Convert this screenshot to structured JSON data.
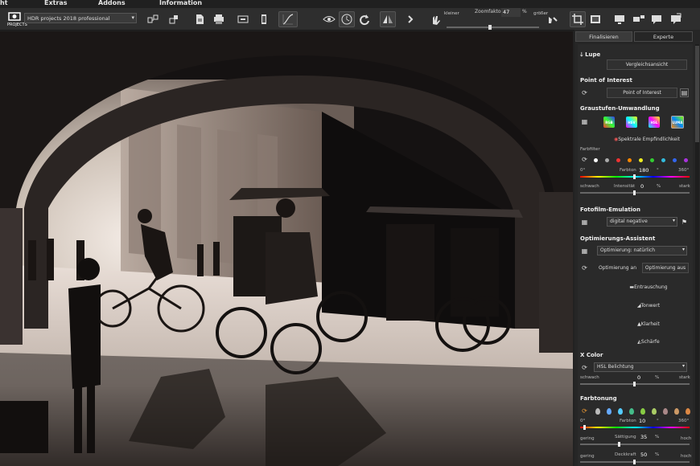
{
  "menu": [
    "ht",
    "Extras",
    "Addons",
    "Information"
  ],
  "toolbar": {
    "logo_text": "PROJECTS",
    "project_select": "HDR projects 2018 professional",
    "zoom_small": "kleiner",
    "zoom_label": "Zoomfaktor",
    "zoom_value": "47",
    "zoom_unit": "%",
    "zoom_large": "größer",
    "zoom_level": 0.47
  },
  "sidebar": {
    "tabs": [
      "Finalisieren",
      "Experte"
    ],
    "lupe": {
      "title": "Lupe",
      "compare": "Vergleichsansicht"
    },
    "poi": {
      "title": "Point of Interest",
      "button": "Point of Interest"
    },
    "grau": {
      "title": "Graustufen-Umwandlung",
      "tiles": [
        "RGB",
        "HSV",
        "HSL",
        "LUMA"
      ],
      "spectral": "Spektrale Empfindlichkeit",
      "filter_label": "Farbfilter",
      "hue_min": "0°",
      "hue_label": "Farbton",
      "hue_value": "180",
      "hue_unit": "°",
      "hue_max": "360°",
      "int_min": "schwach",
      "int_label": "Intensität",
      "int_value": "0",
      "int_unit": "%",
      "int_max": "stark"
    },
    "film": {
      "title": "Fotofilm-Emulation",
      "select": "digital negative"
    },
    "opt": {
      "title": "Optimierungs-Assistent",
      "select": "Optimierung: natürlich",
      "on": "Optimierung an",
      "off": "Optimierung aus",
      "actions": [
        "Entrauschung",
        "Tonwert",
        "Klarheit",
        "Schärfe"
      ]
    },
    "xcolor": {
      "title": "X Color",
      "select": "HSL Belichtung",
      "min": "schwach",
      "value": "0",
      "unit": "%",
      "max": "stark"
    },
    "tone": {
      "title": "Farbtonung",
      "hue_min": "0°",
      "hue_label": "Farbton",
      "hue_value": "10",
      "hue_unit": "°",
      "hue_max": "360°",
      "sat_min": "gering",
      "sat_label": "Sättigung",
      "sat_value": "35",
      "sat_unit": "%",
      "sat_max": "hoch",
      "opa_min": "gering",
      "opa_label": "Deckkraft",
      "opa_value": "50",
      "opa_unit": "%",
      "opa_max": "hoch"
    }
  },
  "colors": {
    "accent": "#5fc7ff",
    "panel": "#2a2a2a",
    "toolbar": "#2e2e2e"
  }
}
